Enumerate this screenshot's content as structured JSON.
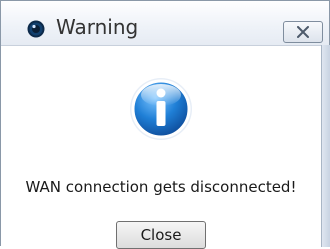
{
  "dialog": {
    "title": "Warning",
    "message": "WAN connection gets disconnected!",
    "close_button_label": "Close",
    "title_icon": "app-icon",
    "close_icon": "close-icon",
    "status_icon": "info-icon"
  },
  "colors": {
    "info_blue": "#1f7fd6",
    "titlebar": "#eef2f8",
    "frame": "#c8d3e2"
  }
}
